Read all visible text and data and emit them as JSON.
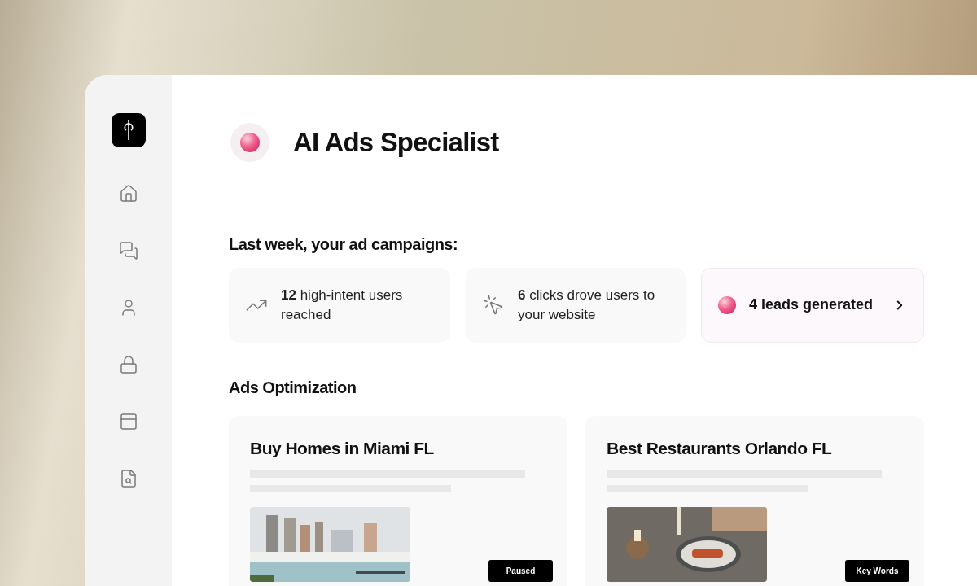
{
  "header": {
    "title": "AI Ads Specialist"
  },
  "summary": {
    "heading": "Last week, your ad campaigns:",
    "stats": [
      {
        "kind": "trend",
        "text": "**12** high-intent users reached"
      },
      {
        "kind": "clicks",
        "text": "**6** clicks drove users to your website"
      },
      {
        "kind": "leads",
        "text": "4 leads generated"
      }
    ]
  },
  "optimization": {
    "heading": "Ads Optimization",
    "campaigns": [
      {
        "title": "Buy Homes in Miami FL",
        "kind": "city",
        "button": "Paused"
      },
      {
        "title": "Best Restaurants Orlando FL",
        "kind": "food",
        "button": "Key Words"
      }
    ]
  }
}
